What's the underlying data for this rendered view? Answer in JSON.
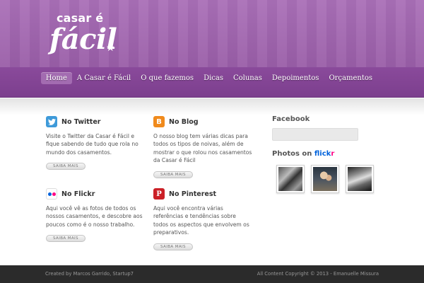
{
  "logo": {
    "top": "casar é",
    "main": "fácil",
    "star": "★"
  },
  "nav": {
    "items": [
      {
        "label": "Home"
      },
      {
        "label": "A Casar é Fácil"
      },
      {
        "label": "O que fazemos"
      },
      {
        "label": "Dicas"
      },
      {
        "label": "Colunas"
      },
      {
        "label": "Depoimentos"
      },
      {
        "label": "Orçamentos"
      }
    ],
    "active": "Home"
  },
  "boxes": {
    "twitter": {
      "icon": "twitter-icon",
      "title": "No Twitter",
      "text": "Visite o Twitter da Casar é Fácil e fique sabendo de tudo que rola no mundo dos casamentos.",
      "button": "SAIBA MAIS"
    },
    "blog": {
      "icon": "blogger-icon",
      "title": "No Blog",
      "text": "O nosso blog tem várias dicas para todos os tipos de noivas, além de mostrar o que rolou nos casamentos da Casar é Fácil",
      "button": "SAIBA MAIS"
    },
    "flickr": {
      "icon": "flickr-icon",
      "title": "No Flickr",
      "text": "Aqui você vê as fotos de todos os nossos casamentos, e descobre aos poucos como é o nosso trabalho.",
      "button": "SAIBA MAIS"
    },
    "pinterest": {
      "icon": "pinterest-icon",
      "title": "No Pinterest",
      "text": "Aqui você encontra várias referências e tendências sobre todos os aspectos que envolvem os preparativos.",
      "button": "SAIBA MAIS"
    }
  },
  "sidebar": {
    "facebook_title": "Facebook",
    "photos_title": "Photos on",
    "flickr_part1": "flick",
    "flickr_part2": "r"
  },
  "footer": {
    "left": "Created by Marcos Garrido, Startup7",
    "right": "All Content Copyright © 2013 - Emanuelle Missura"
  },
  "colors": {
    "header_purple": "#a76bb5",
    "nav_purple": "#7c3f8e",
    "twitter_blue": "#3e9ad9",
    "blogger_orange": "#f08a1c",
    "pinterest_red": "#cb2027",
    "flickr_blue": "#0063dc",
    "flickr_pink": "#ff0084"
  }
}
